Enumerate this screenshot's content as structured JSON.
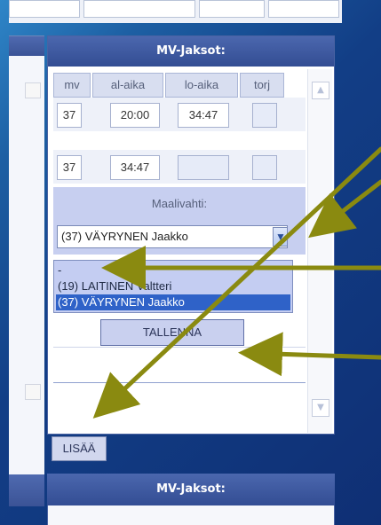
{
  "panel": {
    "title": "MV-Jaksot:",
    "columns": [
      "mv",
      "al-aika",
      "lo-aika",
      "torj"
    ],
    "rows": [
      {
        "mv": "37",
        "al_aika": "20:00",
        "lo_aika": "34:47",
        "torj": ""
      },
      {
        "mv": "37",
        "al_aika": "34:47",
        "lo_aika": "",
        "torj": ""
      }
    ],
    "goalie_label": "Maalivahti:",
    "goalie_select_value": "(37) VÄYRYNEN Jaakko",
    "goalie_options": [
      {
        "label": "-",
        "selected": false
      },
      {
        "label": "(19) LAITINEN Valtteri",
        "selected": false
      },
      {
        "label": "(37) VÄYRYNEN Jaakko",
        "selected": true
      }
    ],
    "save_label": "TALLENNA",
    "add_label": "LISÄÄ"
  },
  "next_panel": {
    "title": "MV-Jaksot:"
  },
  "colors": {
    "background": "#123e86",
    "header": "#3f5aa2",
    "selection": "#2f62c8",
    "arrow": "#8a8a10"
  },
  "icons": {
    "dropdown": "chevron-down-icon",
    "scroll_up": "scroll-up-icon",
    "scroll_down": "scroll-down-icon"
  }
}
